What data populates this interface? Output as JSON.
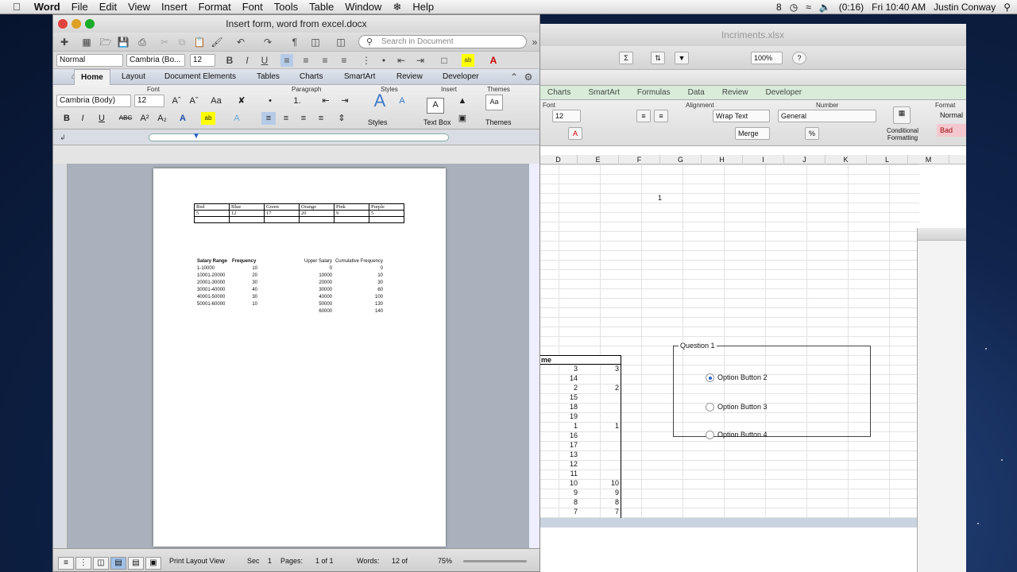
{
  "menubar": {
    "app_name": "Word",
    "items": [
      "File",
      "Edit",
      "View",
      "Insert",
      "Format",
      "Font",
      "Tools",
      "Table",
      "Window",
      "Help"
    ],
    "right": {
      "battery_time": "(0:16)",
      "clock": "Fri 10:40 AM",
      "user": "Justin Conway",
      "badge": "8"
    }
  },
  "word": {
    "window_title": "Insert form, word from excel.docx",
    "search_placeholder": "Search in Document",
    "style_value": "Normal",
    "font_value": "Cambria (Bo...",
    "size_value": "12",
    "tabs": [
      "Home",
      "Layout",
      "Document Elements",
      "Tables",
      "Charts",
      "SmartArt",
      "Review",
      "Developer"
    ],
    "ribbon_groups": [
      "Font",
      "Paragraph",
      "Styles",
      "Insert",
      "Themes"
    ],
    "ribbon_font": "Cambria (Body)",
    "ribbon_size": "12",
    "styles_label": "Styles",
    "textbox_label": "Text Box",
    "themes_label": "Themes",
    "color_table": {
      "headers": [
        "Red",
        "Blue",
        "Green",
        "Orange",
        "Pink",
        "Purple"
      ],
      "values": [
        "5",
        "12",
        "17",
        "20",
        "9",
        "5"
      ]
    },
    "salary_table": {
      "headers": [
        "Salary Range",
        "Frequency",
        "",
        "Upper Salary",
        "Cumulative Frequency"
      ],
      "rows": [
        [
          "1-10000",
          "10",
          "",
          "0",
          "0"
        ],
        [
          "10001-20000",
          "20",
          "",
          "10000",
          "10"
        ],
        [
          "20001-30000",
          "30",
          "",
          "20000",
          "30"
        ],
        [
          "30001-40000",
          "40",
          "",
          "30000",
          "60"
        ],
        [
          "40001-50000",
          "30",
          "",
          "40000",
          "100"
        ],
        [
          "50001-60000",
          "10",
          "",
          "50000",
          "130"
        ],
        [
          "",
          "",
          "",
          "60000",
          "140"
        ]
      ]
    },
    "status": {
      "view": "Print Layout View",
      "sec_label": "Sec",
      "sec_value": "1",
      "pages_label": "Pages:",
      "pages_value": "1 of 1",
      "words_label": "Words:",
      "words_value": "12 of",
      "zoom": "75%"
    }
  },
  "excel": {
    "window_title": "Incriments.xlsx",
    "zoom": "100%",
    "tabs": [
      "Charts",
      "SmartArt",
      "Formulas",
      "Data",
      "Review",
      "Developer"
    ],
    "groups": [
      "Font",
      "Alignment",
      "Number",
      "Format"
    ],
    "font_size": "12",
    "wrap_text": "Wrap Text",
    "merge": "Merge",
    "number_format": "General",
    "cond_formatting": "Conditional Formatting",
    "style_normal": "Normal",
    "style_bad": "Bad",
    "columns": [
      "D",
      "E",
      "F",
      "G",
      "H",
      "I",
      "J",
      "K",
      "L",
      "M"
    ],
    "cell_one": "1",
    "group_title": "Question 1",
    "options": [
      {
        "label": "Option Button 2",
        "selected": true
      },
      {
        "label": "Option Button 3",
        "selected": false
      },
      {
        "label": "Option Button 4",
        "selected": false
      }
    ],
    "col_d_header": "me",
    "col_d": [
      "3",
      "14",
      "2",
      "15",
      "18",
      "19",
      "1",
      "16",
      "17",
      "13",
      "12",
      "11",
      "10",
      "9",
      "8",
      "7"
    ],
    "col_e": [
      "3",
      "",
      "2",
      "",
      "",
      "",
      "1",
      "",
      "",
      "",
      "",
      "",
      "10",
      "9",
      "8",
      "7"
    ]
  }
}
